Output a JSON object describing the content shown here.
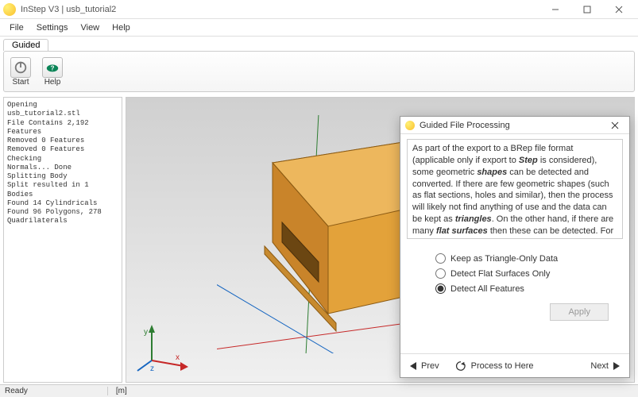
{
  "window": {
    "title": "InStep V3 | usb_tutorial2"
  },
  "menu": {
    "file": "File",
    "settings": "Settings",
    "view": "View",
    "help": "Help"
  },
  "tabs": {
    "guided": "Guided"
  },
  "ribbon": {
    "start": "Start",
    "help": "Help"
  },
  "log": "Opening\nusb_tutorial2.stl\nFile Contains 2,192\nFeatures\nRemoved 0 Features\nRemoved 0 Features\nChecking\nNormals... Done\nSplitting Body\nSplit resulted in 1\nBodies\nFound 14 Cylindricals\nFound 96 Polygons, 278\nQuadrilaterals",
  "status": {
    "ready": "Ready",
    "unit": "[m]"
  },
  "axis": {
    "x": "x",
    "y": "y",
    "z": "z"
  },
  "dialog": {
    "title": "Guided File Processing",
    "desc_plain": "As part of the export to a BRep file format (applicable only if export to Step is considered), some geometric shapes can be detected and converted. If there are few geometric shapes (such as flat sections, holes and similar), then the process will likely not find anything of use and the data can be kept as triangles. On the other hand, if there are many flat surfaces then these can be detected. For cases where there is a mixture of flat and cylindrical/conical shapes, all features may be detected.",
    "options": {
      "triangle": "Keep as Triangle-Only Data",
      "flat": "Detect Flat Surfaces Only",
      "all": "Detect All Features",
      "selected": "all"
    },
    "apply": "Apply",
    "prev": "Prev",
    "process": "Process to Here",
    "next": "Next"
  }
}
